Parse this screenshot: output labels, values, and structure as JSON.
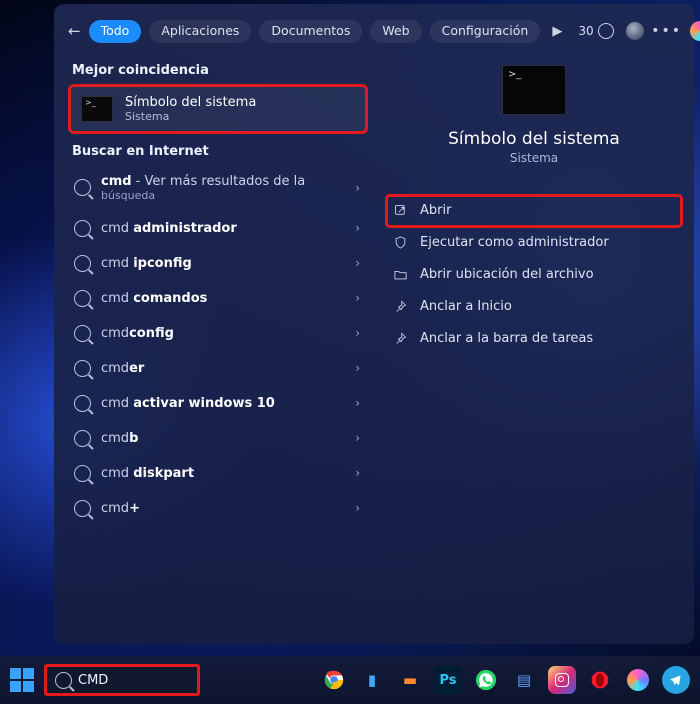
{
  "top": {
    "tabs": [
      "Todo",
      "Aplicaciones",
      "Documentos",
      "Web",
      "Configuración"
    ],
    "active_index": 0,
    "points": "30"
  },
  "left": {
    "section_best": "Mejor coincidencia",
    "best_match": {
      "title": "Símbolo del sistema",
      "subtitle": "Sistema"
    },
    "section_web": "Buscar en Internet",
    "items": [
      {
        "term": "cmd",
        "rest": " - Ver más resultados de la búsqueda",
        "multiline": true
      },
      {
        "term": "cmd ",
        "bold": "administrador"
      },
      {
        "term": "cmd ",
        "bold": "ipconfig"
      },
      {
        "term": "cmd ",
        "bold": "comandos"
      },
      {
        "term": "cmd",
        "bold": "config"
      },
      {
        "term": "cmd",
        "bold": "er"
      },
      {
        "term": "cmd ",
        "bold": "activar windows 10"
      },
      {
        "term": "cmd",
        "bold": "b"
      },
      {
        "term": "cmd ",
        "bold": "diskpart"
      },
      {
        "term": "cmd",
        "bold": "+"
      }
    ]
  },
  "right": {
    "title": "Símbolo del sistema",
    "subtitle": "Sistema",
    "actions": [
      {
        "id": "open",
        "label": "Abrir",
        "highlight": true,
        "icon": "open"
      },
      {
        "id": "admin",
        "label": "Ejecutar como administrador",
        "icon": "shield"
      },
      {
        "id": "loc",
        "label": "Abrir ubicación del archivo",
        "icon": "folder"
      },
      {
        "id": "pin-start",
        "label": "Anclar a Inicio",
        "icon": "pin"
      },
      {
        "id": "pin-task",
        "label": "Anclar a la barra de tareas",
        "icon": "pin"
      }
    ]
  },
  "taskbar": {
    "query": "CMD"
  }
}
